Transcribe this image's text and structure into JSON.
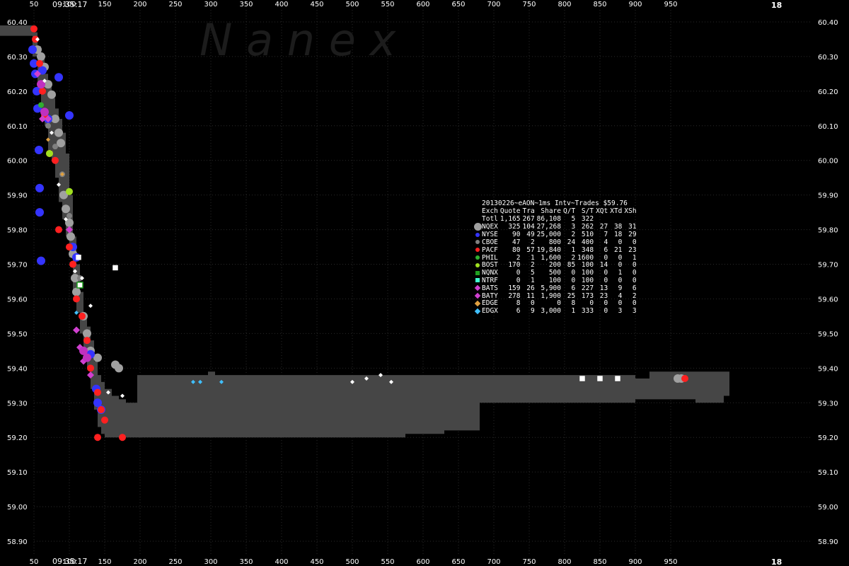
{
  "corner_labels": {
    "top_left": "09:35:17",
    "bottom_left": "09:35:17",
    "top_right": "18",
    "bottom_right": "18"
  },
  "watermark": "N a n e x",
  "chart_data": {
    "type": "scatter",
    "title": "",
    "xlabel": "",
    "ylabel": "",
    "xlim": [
      0,
      1000
    ],
    "ylim": [
      58.85,
      60.42
    ],
    "grid": true,
    "x_ticks": [
      50,
      100,
      150,
      200,
      250,
      300,
      350,
      400,
      450,
      500,
      550,
      600,
      650,
      700,
      750,
      800,
      850,
      900,
      950
    ],
    "y_ticks": [
      60.4,
      60.3,
      60.2,
      60.1,
      60.0,
      59.9,
      59.8,
      59.7,
      59.6,
      59.5,
      59.4,
      59.3,
      59.2,
      59.1,
      59.0,
      58.9
    ],
    "nbbo_band": [
      [
        -5,
        60.39,
        60.36
      ],
      [
        45,
        60.39,
        60.36
      ],
      [
        48,
        60.37,
        60.3
      ],
      [
        55,
        60.33,
        60.22
      ],
      [
        60,
        60.3,
        60.15
      ],
      [
        65,
        60.25,
        60.1
      ],
      [
        70,
        60.22,
        60.03
      ],
      [
        75,
        60.18,
        60.0
      ],
      [
        80,
        60.15,
        59.95
      ],
      [
        85,
        60.12,
        59.88
      ],
      [
        90,
        60.08,
        59.83
      ],
      [
        95,
        60.02,
        59.78
      ],
      [
        100,
        59.9,
        59.72
      ],
      [
        105,
        59.78,
        59.62
      ],
      [
        110,
        59.7,
        59.56
      ],
      [
        115,
        59.62,
        59.5
      ],
      [
        120,
        59.55,
        59.45
      ],
      [
        125,
        59.52,
        59.4
      ],
      [
        130,
        59.48,
        59.34
      ],
      [
        135,
        59.42,
        59.28
      ],
      [
        140,
        59.38,
        59.23
      ],
      [
        145,
        59.36,
        59.21
      ],
      [
        150,
        59.34,
        59.2
      ],
      [
        160,
        59.32,
        59.2
      ],
      [
        170,
        59.31,
        59.2
      ],
      [
        180,
        59.3,
        59.2
      ],
      [
        195,
        59.3,
        59.2
      ],
      [
        196,
        59.38,
        59.2
      ],
      [
        295,
        59.38,
        59.2
      ],
      [
        296,
        59.39,
        59.2
      ],
      [
        305,
        59.39,
        59.2
      ],
      [
        306,
        59.38,
        59.2
      ],
      [
        570,
        59.38,
        59.2
      ],
      [
        575,
        59.38,
        59.21
      ],
      [
        625,
        59.38,
        59.21
      ],
      [
        630,
        59.38,
        59.22
      ],
      [
        675,
        59.38,
        59.22
      ],
      [
        680,
        59.38,
        59.3
      ],
      [
        895,
        59.38,
        59.3
      ],
      [
        900,
        59.37,
        59.31
      ],
      [
        920,
        59.39,
        59.31
      ],
      [
        985,
        59.39,
        59.3
      ],
      [
        1020,
        59.39,
        59.3
      ],
      [
        1025,
        59.39,
        59.32
      ],
      [
        1033,
        59.39,
        59.32
      ]
    ],
    "series": [
      {
        "name": "NQEX",
        "color": "#a0a0a0",
        "shape": "circle",
        "size": 6,
        "points": [
          [
            55,
            60.32
          ],
          [
            60,
            60.3
          ],
          [
            65,
            60.27
          ],
          [
            70,
            60.22
          ],
          [
            75,
            60.19
          ],
          [
            80,
            60.12
          ],
          [
            85,
            60.08
          ],
          [
            88,
            60.05
          ],
          [
            92,
            59.9
          ],
          [
            95,
            59.86
          ],
          [
            100,
            59.82
          ],
          [
            102,
            59.78
          ],
          [
            105,
            59.73
          ],
          [
            108,
            59.66
          ],
          [
            110,
            59.62
          ],
          [
            120,
            59.55
          ],
          [
            125,
            59.5
          ],
          [
            130,
            59.45
          ],
          [
            140,
            59.43
          ],
          [
            165,
            59.41
          ],
          [
            170,
            59.4
          ],
          [
            960,
            59.37
          ],
          [
            965,
            59.37
          ]
        ]
      },
      {
        "name": "NYSE",
        "color": "#3434ff",
        "shape": "circle",
        "size": 6,
        "points": [
          [
            48,
            60.32
          ],
          [
            50,
            60.28
          ],
          [
            52,
            60.25
          ],
          [
            54,
            60.2
          ],
          [
            55,
            60.15
          ],
          [
            57,
            60.03
          ],
          [
            58,
            59.92
          ],
          [
            58,
            59.85
          ],
          [
            60,
            59.71
          ],
          [
            62,
            60.26
          ],
          [
            70,
            60.12
          ],
          [
            85,
            60.24
          ],
          [
            100,
            60.13
          ],
          [
            105,
            59.75
          ],
          [
            110,
            59.72
          ],
          [
            130,
            59.44
          ],
          [
            138,
            59.34
          ],
          [
            140,
            59.3
          ],
          [
            145,
            59.28
          ]
        ]
      },
      {
        "name": "CBOE",
        "color": "#808080",
        "shape": "circle",
        "size": 4,
        "points": [
          [
            60,
            60.22
          ],
          [
            70,
            60.1
          ],
          [
            80,
            60.04
          ],
          [
            90,
            59.96
          ],
          [
            100,
            59.84
          ],
          [
            115,
            59.66
          ]
        ]
      },
      {
        "name": "PACF",
        "color": "#ff2020",
        "shape": "circle",
        "size": 5,
        "points": [
          [
            50,
            60.38
          ],
          [
            52,
            60.35
          ],
          [
            58,
            60.28
          ],
          [
            62,
            60.2
          ],
          [
            65,
            60.13
          ],
          [
            72,
            60.02
          ],
          [
            80,
            60.0
          ],
          [
            85,
            59.8
          ],
          [
            100,
            59.75
          ],
          [
            105,
            59.7
          ],
          [
            110,
            59.6
          ],
          [
            118,
            59.55
          ],
          [
            125,
            59.48
          ],
          [
            130,
            59.4
          ],
          [
            140,
            59.33
          ],
          [
            145,
            59.28
          ],
          [
            150,
            59.25
          ],
          [
            175,
            59.2
          ],
          [
            140,
            59.2
          ],
          [
            970,
            59.37
          ]
        ]
      },
      {
        "name": "PHIL",
        "color": "#30b030",
        "shape": "circle",
        "size": 4,
        "points": [
          [
            60,
            60.16
          ]
        ]
      },
      {
        "name": "BOST",
        "color": "#a0e020",
        "shape": "circle",
        "size": 5,
        "points": [
          [
            72,
            60.02
          ],
          [
            100,
            59.91
          ]
        ]
      },
      {
        "name": "NQNX",
        "color": "#20a020",
        "shape": "square",
        "size": 4,
        "points": [
          [
            115,
            59.64
          ]
        ]
      },
      {
        "name": "NTRF",
        "color": "#ffffff",
        "shape": "square",
        "size": 3,
        "points": [
          [
            113,
            59.72
          ],
          [
            165,
            59.69
          ],
          [
            825,
            59.37
          ],
          [
            850,
            59.37
          ],
          [
            875,
            59.37
          ]
        ]
      },
      {
        "name": "BATS",
        "color": "#d040d0",
        "shape": "diamond",
        "size": 5,
        "points": [
          [
            55,
            60.25
          ],
          [
            62,
            60.12
          ],
          [
            70,
            60.12
          ],
          [
            100,
            59.8
          ],
          [
            110,
            59.51
          ],
          [
            115,
            59.46
          ],
          [
            120,
            59.42
          ],
          [
            130,
            59.38
          ]
        ]
      },
      {
        "name": "BATY",
        "color": "#c030c0",
        "shape": "circle",
        "size": 6,
        "points": [
          [
            60,
            60.22
          ],
          [
            65,
            60.14
          ],
          [
            120,
            59.45
          ],
          [
            125,
            59.43
          ]
        ]
      },
      {
        "name": "EDGE",
        "color": "#e0a040",
        "shape": "diamond",
        "size": 3,
        "points": [
          [
            70,
            60.06
          ],
          [
            90,
            59.96
          ]
        ]
      },
      {
        "name": "EDGX",
        "color": "#40c0ff",
        "shape": "diamond",
        "size": 3,
        "points": [
          [
            110,
            59.56
          ],
          [
            275,
            59.36
          ],
          [
            285,
            59.36
          ],
          [
            315,
            59.36
          ]
        ]
      },
      {
        "name": "",
        "color": "#ffffff",
        "shape": "diamond",
        "size": 3,
        "points": [
          [
            55,
            60.35
          ],
          [
            65,
            60.23
          ],
          [
            75,
            60.08
          ],
          [
            85,
            59.93
          ],
          [
            95,
            59.83
          ],
          [
            108,
            59.68
          ],
          [
            118,
            59.66
          ],
          [
            130,
            59.58
          ],
          [
            155,
            59.33
          ],
          [
            175,
            59.32
          ],
          [
            500,
            59.36
          ],
          [
            520,
            59.37
          ],
          [
            540,
            59.38
          ],
          [
            555,
            59.36
          ]
        ]
      }
    ],
    "table": {
      "title": "20130226~eAON~1ms Intv~Trades $59.76",
      "columns": [
        "Exch",
        "Quote",
        "Tra",
        "Share",
        "Q/T",
        "S/T",
        "XQt",
        "XTd",
        "XSh"
      ],
      "rows": [
        {
          "exch": "Totl",
          "quote": "1,165",
          "tra": "267",
          "share": "86,108",
          "qt": "5",
          "st": "322",
          "xqt": "",
          "xtd": "",
          "xsh": "",
          "marker": "",
          "color": ""
        },
        {
          "exch": "NQEX",
          "quote": "325",
          "tra": "104",
          "share": "27,268",
          "qt": "3",
          "st": "262",
          "xqt": "27",
          "xtd": "38",
          "xsh": "31",
          "marker": "big",
          "color": "#a0a0a0"
        },
        {
          "exch": "NYSE",
          "quote": "90",
          "tra": "49",
          "share": "25,000",
          "qt": "2",
          "st": "510",
          "xqt": "7",
          "xtd": "18",
          "xsh": "29",
          "marker": "dot",
          "color": "#3434ff"
        },
        {
          "exch": "CBOE",
          "quote": "47",
          "tra": "2",
          "share": "800",
          "qt": "24",
          "st": "400",
          "xqt": "4",
          "xtd": "0",
          "xsh": "0",
          "marker": "dot",
          "color": "#808080"
        },
        {
          "exch": "PACF",
          "quote": "80",
          "tra": "57",
          "share": "19,840",
          "qt": "1",
          "st": "348",
          "xqt": "6",
          "xtd": "21",
          "xsh": "23",
          "marker": "dot",
          "color": "#ff2020"
        },
        {
          "exch": "PHIL",
          "quote": "2",
          "tra": "1",
          "share": "1,600",
          "qt": "2",
          "st": "1600",
          "xqt": "0",
          "xtd": "0",
          "xsh": "1",
          "marker": "dot",
          "color": "#30b030"
        },
        {
          "exch": "BOST",
          "quote": "170",
          "tra": "2",
          "share": "200",
          "qt": "85",
          "st": "100",
          "xqt": "14",
          "xtd": "0",
          "xsh": "0",
          "marker": "dot",
          "color": "#a0e020"
        },
        {
          "exch": "NQNX",
          "quote": "0",
          "tra": "5",
          "share": "500",
          "qt": "0",
          "st": "100",
          "xqt": "0",
          "xtd": "1",
          "xsh": "0",
          "marker": "sq",
          "color": "#20a020"
        },
        {
          "exch": "NTRF",
          "quote": "0",
          "tra": "1",
          "share": "100",
          "qt": "0",
          "st": "100",
          "xqt": "0",
          "xtd": "0",
          "xsh": "0",
          "marker": "sq",
          "color": "#40ffd0"
        },
        {
          "exch": "BATS",
          "quote": "159",
          "tra": "26",
          "share": "5,900",
          "qt": "6",
          "st": "227",
          "xqt": "13",
          "xtd": "9",
          "xsh": "6",
          "marker": "dia",
          "color": "#d040d0"
        },
        {
          "exch": "BATY",
          "quote": "278",
          "tra": "11",
          "share": "1,900",
          "qt": "25",
          "st": "173",
          "xqt": "23",
          "xtd": "4",
          "xsh": "2",
          "marker": "dia",
          "color": "#d040d0"
        },
        {
          "exch": "EDGE",
          "quote": "8",
          "tra": "0",
          "share": "0",
          "qt": "8",
          "st": "0",
          "xqt": "0",
          "xtd": "0",
          "xsh": "0",
          "marker": "dia",
          "color": "#e0a040"
        },
        {
          "exch": "EDGX",
          "quote": "6",
          "tra": "9",
          "share": "3,000",
          "qt": "1",
          "st": "333",
          "xqt": "0",
          "xtd": "3",
          "xsh": "3",
          "marker": "dia",
          "color": "#40c0ff"
        }
      ]
    }
  }
}
